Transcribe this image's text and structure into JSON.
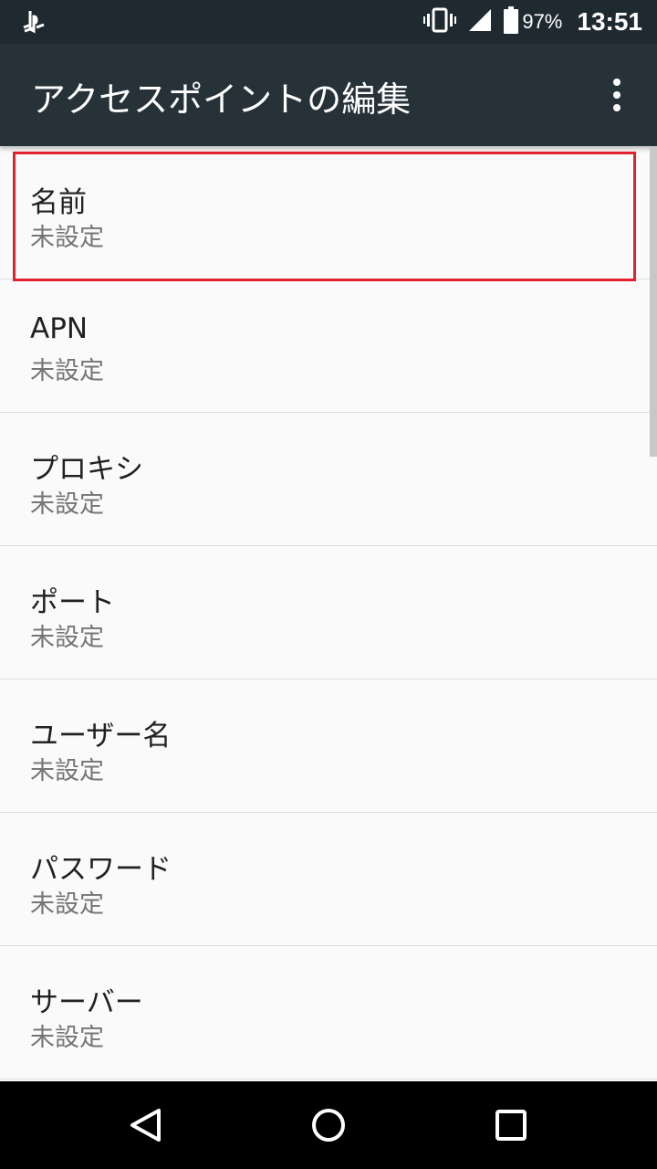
{
  "status_bar": {
    "left_icon": "playstation-icon",
    "vibrate_icon": "vibrate-icon",
    "signal_icon": "signal-icon",
    "battery_icon": "battery-icon",
    "battery_percent": "97%",
    "time": "13:51"
  },
  "app_bar": {
    "title": "アクセスポイントの編集",
    "menu_icon": "more-vert-icon"
  },
  "settings": {
    "items": [
      {
        "title": "名前",
        "summary": "未設定"
      },
      {
        "title": "APN",
        "summary": "未設定"
      },
      {
        "title": "プロキシ",
        "summary": "未設定"
      },
      {
        "title": "ポート",
        "summary": "未設定"
      },
      {
        "title": "ユーザー名",
        "summary": "未設定"
      },
      {
        "title": "パスワード",
        "summary": "未設定"
      },
      {
        "title": "サーバー",
        "summary": "未設定"
      }
    ]
  },
  "nav_bar": {
    "back_icon": "back-triangle-icon",
    "home_icon": "home-circle-icon",
    "recents_icon": "recents-square-icon"
  },
  "colors": {
    "status_bar_bg": "#1f2a30",
    "app_bar_bg": "#263238",
    "list_bg": "#fafafa",
    "highlight_border": "#e3202d"
  }
}
